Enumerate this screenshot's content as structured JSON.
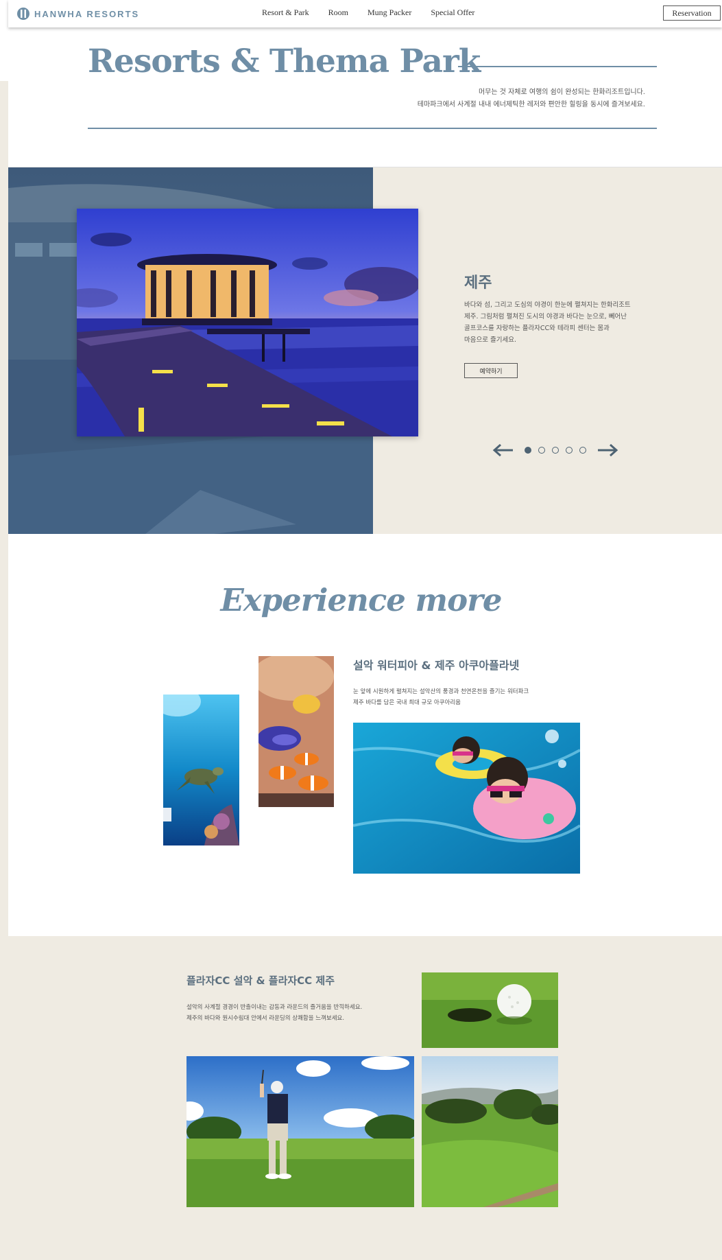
{
  "header": {
    "logo_text": "HANWHA RESORTS",
    "nav": [
      "Resort & Park",
      "Room",
      "Mung Packer",
      "Special Offer"
    ],
    "reservation_label": "Reservation"
  },
  "hero": {
    "title": "Resorts & Thema Park",
    "desc_line1": "머무는 것 자체로 여행의 쉼이 완성되는 한화리조트입니다.",
    "desc_line2": "테마파크에서 사계절 내내 에너제틱한 레저와 편안한 힐링을 동시에 즐겨보세요."
  },
  "slider": {
    "title": "제주",
    "desc_lines": [
      "바다와 섬, 그리고 도심의 야경이 한눈에 펼쳐지는 한화리조트",
      "제주. 그림처럼 펼쳐진 도시의 야경과 바다는 눈으로, 뻬어난",
      "골프코스를 자랑하는 플라자CC와 테라피 센터는 몸과",
      "마음으로 즐기세요."
    ],
    "button_label": "예약하기",
    "dot_count": 5,
    "active_index": 0
  },
  "experience": {
    "title": "Experience more",
    "heading": "설악 워터피아 & 제주 아쿠아플라넷",
    "desc_line1": "눈 앞에 시원하게 펼쳐지는 설악산의 풍경과 천연온천을 즐기는 워터파크",
    "desc_line2": "제주 바다를 담은 국내 최대 규모 아쿠아리움"
  },
  "golf": {
    "heading": "플라자CC 설악 & 플라자CC 제주",
    "desc_line1": "설악의 사계절 경경이 반출이내는 감동과 라운드의 즐거움을 반끽하세요.",
    "desc_line2": "제주의 바다와 원시수림대 안에서 라운딩의 상쾌함을 느껴보세요."
  },
  "colors": {
    "accent": "#6f8ea6",
    "beige": "#efebe2",
    "heading": "#5b6f7f"
  }
}
